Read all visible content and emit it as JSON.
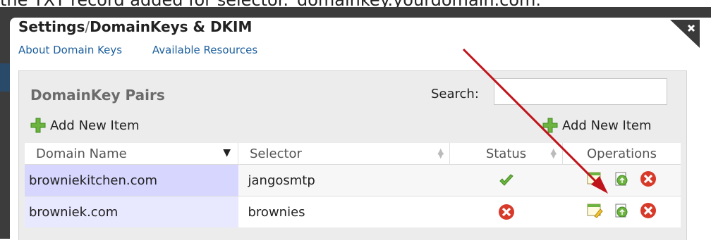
{
  "caption": "the TXT record added for selector._domainkey.yourdomain.com.",
  "modal": {
    "title_main": "Settings",
    "title_sep": "/",
    "title_sub": "DomainKeys & DKIM",
    "links": [
      "About Domain Keys",
      "Available Resources"
    ]
  },
  "panel": {
    "title": "DomainKey Pairs",
    "search_label": "Search:",
    "search_value": "",
    "add_left": "Add New Item",
    "add_right": "Add New Item"
  },
  "table": {
    "headers": [
      "Domain Name",
      "Selector",
      "Status",
      "Operations"
    ],
    "rows": [
      {
        "domain": "browniekitchen.com",
        "selector": "jangosmtp",
        "status": "enabled"
      },
      {
        "domain": "browniek.com",
        "selector": "brownies",
        "status": "disabled"
      }
    ]
  },
  "colors": {
    "link": "#1d5f9e",
    "annotation_arrow": "#c0141b",
    "status_ok": "#5aa02c",
    "status_error": "#d83a2a"
  },
  "icons": [
    "close-icon",
    "plus-icon",
    "sort-icon",
    "checkmark-icon",
    "delete-icon",
    "disable-key-icon",
    "edit-key-icon",
    "view-key-icon"
  ]
}
